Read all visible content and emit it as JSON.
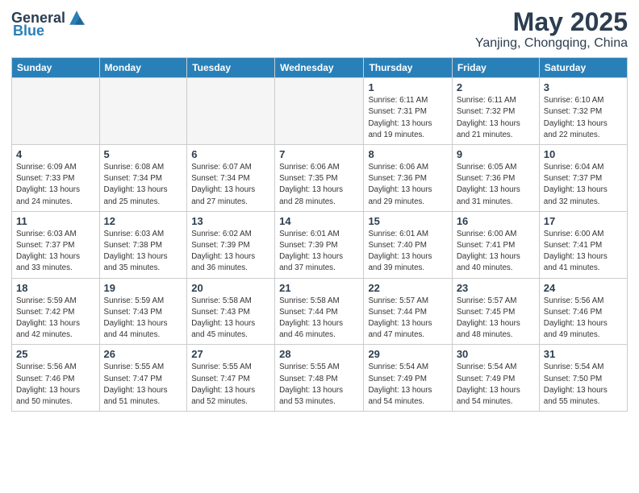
{
  "header": {
    "logo_general": "General",
    "logo_blue": "Blue",
    "title": "May 2025",
    "subtitle": "Yanjing, Chongqing, China"
  },
  "calendar": {
    "days_of_week": [
      "Sunday",
      "Monday",
      "Tuesday",
      "Wednesday",
      "Thursday",
      "Friday",
      "Saturday"
    ],
    "weeks": [
      [
        {
          "day": "",
          "info": ""
        },
        {
          "day": "",
          "info": ""
        },
        {
          "day": "",
          "info": ""
        },
        {
          "day": "",
          "info": ""
        },
        {
          "day": "1",
          "info": "Sunrise: 6:11 AM\nSunset: 7:31 PM\nDaylight: 13 hours\nand 19 minutes."
        },
        {
          "day": "2",
          "info": "Sunrise: 6:11 AM\nSunset: 7:32 PM\nDaylight: 13 hours\nand 21 minutes."
        },
        {
          "day": "3",
          "info": "Sunrise: 6:10 AM\nSunset: 7:32 PM\nDaylight: 13 hours\nand 22 minutes."
        }
      ],
      [
        {
          "day": "4",
          "info": "Sunrise: 6:09 AM\nSunset: 7:33 PM\nDaylight: 13 hours\nand 24 minutes."
        },
        {
          "day": "5",
          "info": "Sunrise: 6:08 AM\nSunset: 7:34 PM\nDaylight: 13 hours\nand 25 minutes."
        },
        {
          "day": "6",
          "info": "Sunrise: 6:07 AM\nSunset: 7:34 PM\nDaylight: 13 hours\nand 27 minutes."
        },
        {
          "day": "7",
          "info": "Sunrise: 6:06 AM\nSunset: 7:35 PM\nDaylight: 13 hours\nand 28 minutes."
        },
        {
          "day": "8",
          "info": "Sunrise: 6:06 AM\nSunset: 7:36 PM\nDaylight: 13 hours\nand 29 minutes."
        },
        {
          "day": "9",
          "info": "Sunrise: 6:05 AM\nSunset: 7:36 PM\nDaylight: 13 hours\nand 31 minutes."
        },
        {
          "day": "10",
          "info": "Sunrise: 6:04 AM\nSunset: 7:37 PM\nDaylight: 13 hours\nand 32 minutes."
        }
      ],
      [
        {
          "day": "11",
          "info": "Sunrise: 6:03 AM\nSunset: 7:37 PM\nDaylight: 13 hours\nand 33 minutes."
        },
        {
          "day": "12",
          "info": "Sunrise: 6:03 AM\nSunset: 7:38 PM\nDaylight: 13 hours\nand 35 minutes."
        },
        {
          "day": "13",
          "info": "Sunrise: 6:02 AM\nSunset: 7:39 PM\nDaylight: 13 hours\nand 36 minutes."
        },
        {
          "day": "14",
          "info": "Sunrise: 6:01 AM\nSunset: 7:39 PM\nDaylight: 13 hours\nand 37 minutes."
        },
        {
          "day": "15",
          "info": "Sunrise: 6:01 AM\nSunset: 7:40 PM\nDaylight: 13 hours\nand 39 minutes."
        },
        {
          "day": "16",
          "info": "Sunrise: 6:00 AM\nSunset: 7:41 PM\nDaylight: 13 hours\nand 40 minutes."
        },
        {
          "day": "17",
          "info": "Sunrise: 6:00 AM\nSunset: 7:41 PM\nDaylight: 13 hours\nand 41 minutes."
        }
      ],
      [
        {
          "day": "18",
          "info": "Sunrise: 5:59 AM\nSunset: 7:42 PM\nDaylight: 13 hours\nand 42 minutes."
        },
        {
          "day": "19",
          "info": "Sunrise: 5:59 AM\nSunset: 7:43 PM\nDaylight: 13 hours\nand 44 minutes."
        },
        {
          "day": "20",
          "info": "Sunrise: 5:58 AM\nSunset: 7:43 PM\nDaylight: 13 hours\nand 45 minutes."
        },
        {
          "day": "21",
          "info": "Sunrise: 5:58 AM\nSunset: 7:44 PM\nDaylight: 13 hours\nand 46 minutes."
        },
        {
          "day": "22",
          "info": "Sunrise: 5:57 AM\nSunset: 7:44 PM\nDaylight: 13 hours\nand 47 minutes."
        },
        {
          "day": "23",
          "info": "Sunrise: 5:57 AM\nSunset: 7:45 PM\nDaylight: 13 hours\nand 48 minutes."
        },
        {
          "day": "24",
          "info": "Sunrise: 5:56 AM\nSunset: 7:46 PM\nDaylight: 13 hours\nand 49 minutes."
        }
      ],
      [
        {
          "day": "25",
          "info": "Sunrise: 5:56 AM\nSunset: 7:46 PM\nDaylight: 13 hours\nand 50 minutes."
        },
        {
          "day": "26",
          "info": "Sunrise: 5:55 AM\nSunset: 7:47 PM\nDaylight: 13 hours\nand 51 minutes."
        },
        {
          "day": "27",
          "info": "Sunrise: 5:55 AM\nSunset: 7:47 PM\nDaylight: 13 hours\nand 52 minutes."
        },
        {
          "day": "28",
          "info": "Sunrise: 5:55 AM\nSunset: 7:48 PM\nDaylight: 13 hours\nand 53 minutes."
        },
        {
          "day": "29",
          "info": "Sunrise: 5:54 AM\nSunset: 7:49 PM\nDaylight: 13 hours\nand 54 minutes."
        },
        {
          "day": "30",
          "info": "Sunrise: 5:54 AM\nSunset: 7:49 PM\nDaylight: 13 hours\nand 54 minutes."
        },
        {
          "day": "31",
          "info": "Sunrise: 5:54 AM\nSunset: 7:50 PM\nDaylight: 13 hours\nand 55 minutes."
        }
      ]
    ]
  }
}
